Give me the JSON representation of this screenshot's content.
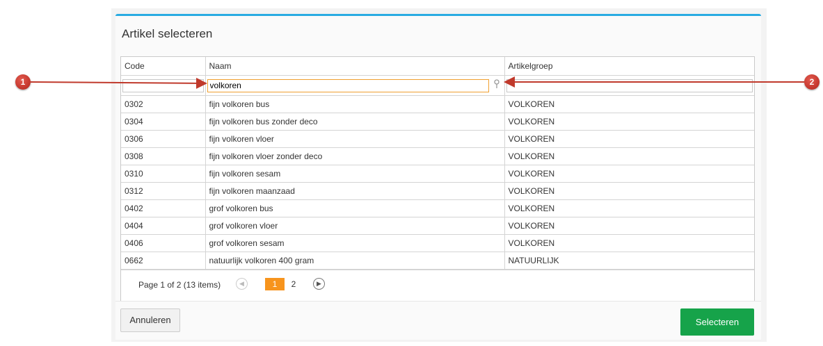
{
  "dialog": {
    "title": "Artikel selecteren"
  },
  "grid": {
    "columns": [
      "Code",
      "Naam",
      "Artikelgroep"
    ],
    "filters": {
      "code": "",
      "naam": "volkoren",
      "artikelgroep": ""
    },
    "rows": [
      [
        "0302",
        "fijn volkoren bus",
        "VOLKOREN"
      ],
      [
        "0304",
        "fijn volkoren bus zonder deco",
        "VOLKOREN"
      ],
      [
        "0306",
        "fijn volkoren vloer",
        "VOLKOREN"
      ],
      [
        "0308",
        "fijn volkoren vloer zonder deco",
        "VOLKOREN"
      ],
      [
        "0310",
        "fijn volkoren sesam",
        "VOLKOREN"
      ],
      [
        "0312",
        "fijn volkoren maanzaad",
        "VOLKOREN"
      ],
      [
        "0402",
        "grof volkoren bus",
        "VOLKOREN"
      ],
      [
        "0404",
        "grof volkoren vloer",
        "VOLKOREN"
      ],
      [
        "0406",
        "grof volkoren sesam",
        "VOLKOREN"
      ],
      [
        "0662",
        "natuurlijk volkoren 400 gram",
        "NATUURLIJK"
      ]
    ]
  },
  "pager": {
    "summary": "Page 1 of 2 (13 items)",
    "pages": [
      "1",
      "2"
    ],
    "current_page": "1"
  },
  "buttons": {
    "cancel": "Annuleren",
    "select": "Selecteren"
  },
  "callouts": [
    "1",
    "2"
  ],
  "colors": {
    "accent_top": "#29abe2",
    "select_button": "#16a34a",
    "active_page": "#f7941d",
    "callout": "#c0392b"
  },
  "icons": {
    "filter": "filter-pin-icon",
    "prev": "chevron-left-icon",
    "next": "chevron-right-icon"
  }
}
